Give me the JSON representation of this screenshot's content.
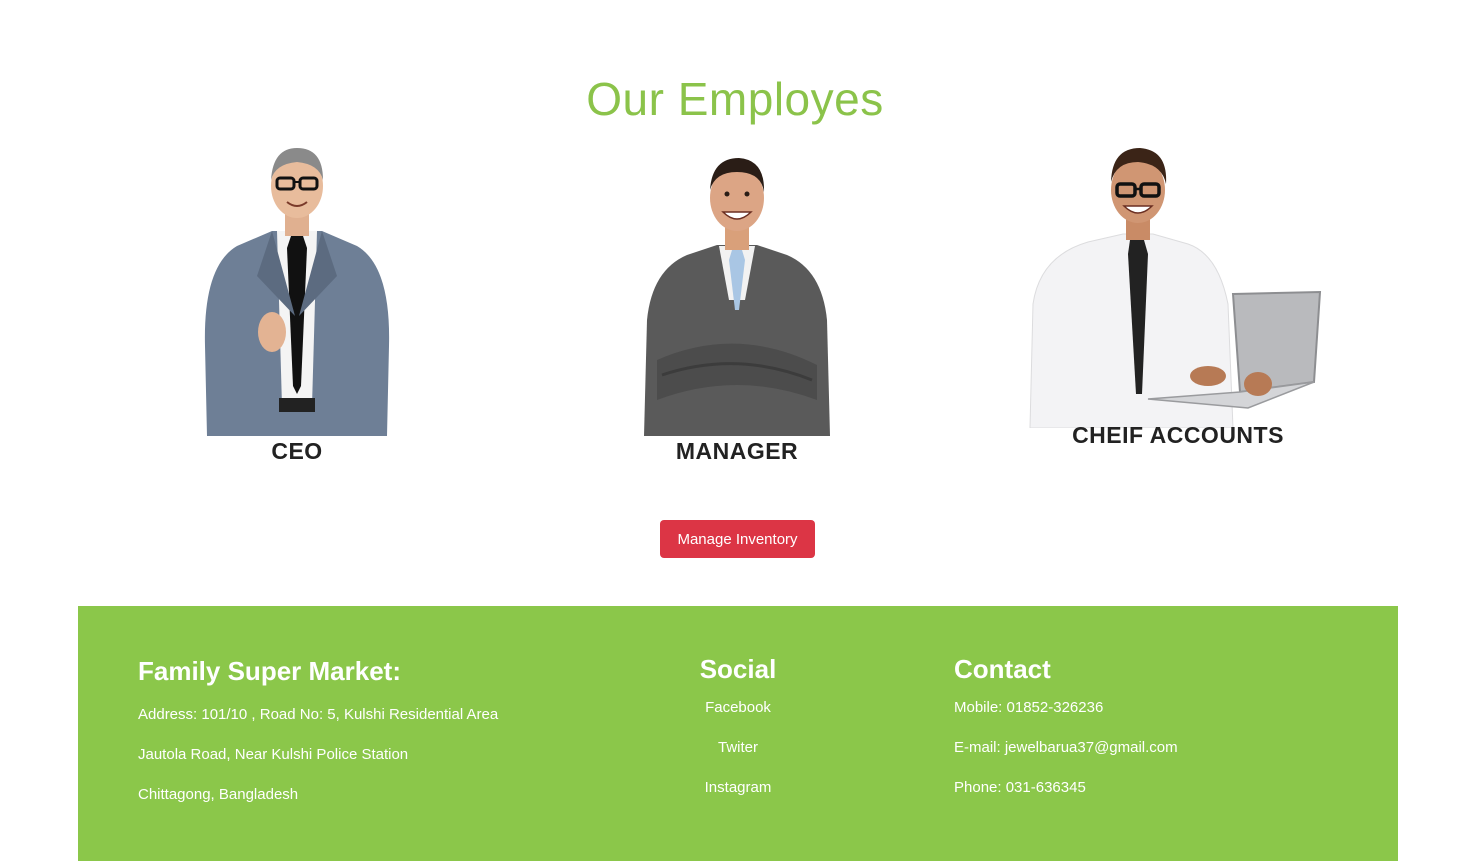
{
  "section": {
    "title": "Our Employes"
  },
  "employees": [
    {
      "role": "CEO"
    },
    {
      "role": "MANAGER"
    },
    {
      "role": "CHEIF ACCOUNTS"
    }
  ],
  "actions": {
    "manage_label": "Manage Inventory"
  },
  "footer": {
    "about": {
      "heading": "Family Super Market:",
      "lines": [
        "Address: 101/10 , Road No: 5, Kulshi Residential Area",
        "Jautola Road, Near Kulshi Police Station",
        "Chittagong, Bangladesh"
      ]
    },
    "social": {
      "heading": "Social",
      "links": [
        "Facebook",
        "Twiter",
        "Instagram"
      ]
    },
    "contact": {
      "heading": "Contact",
      "lines": [
        "Mobile: 01852-326236",
        "E-mail: jewelbarua37@gmail.com",
        "Phone: 031-636345"
      ]
    }
  },
  "colors": {
    "accent": "#8bc34a",
    "footer_bg": "#8bc74a",
    "button": "#dc3545"
  }
}
